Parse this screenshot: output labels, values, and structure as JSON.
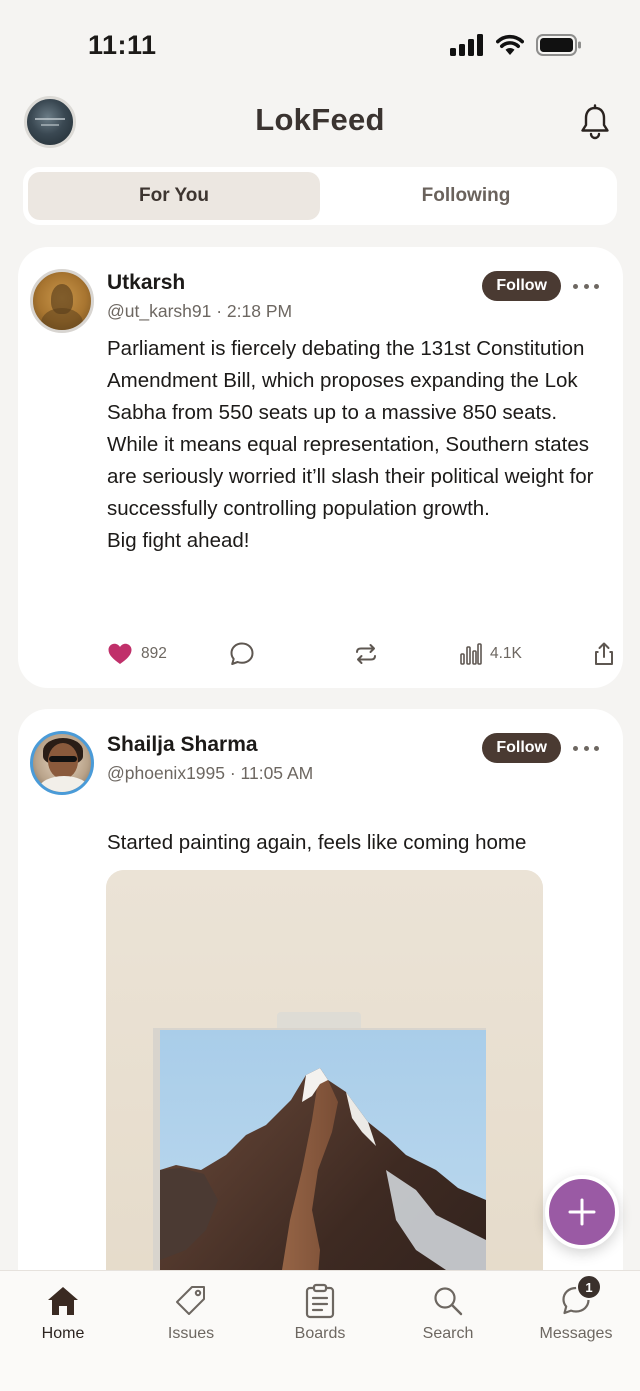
{
  "status_bar": {
    "time": "11:11"
  },
  "header": {
    "title": "LokFeed"
  },
  "tabs": [
    {
      "label": "For You",
      "active": true
    },
    {
      "label": "Following",
      "active": false
    }
  ],
  "posts": [
    {
      "name": "Utkarsh",
      "handle": "@ut_karsh91",
      "time": "2:18 PM",
      "meta": "@ut_karsh91 · 2:18 PM",
      "follow_label": "Follow",
      "text": "Parliament is fiercely debating the 131st Constitution Amendment Bill, which proposes expanding the Lok Sabha from 550 seats up to a massive 850 seats.\nWhile it means equal representation, Southern states are seriously worried it’ll slash their political weight for successfully controlling population growth.\n Big fight ahead!",
      "likes": "892",
      "views": "4.1K",
      "liked": true
    },
    {
      "name": "Shailja Sharma",
      "handle": "@phoenix1995",
      "time": "11:05 AM",
      "meta": "@phoenix1995 · 11:05 AM",
      "follow_label": "Follow",
      "text": "Started painting again, feels like coming home",
      "emoji": "😊"
    }
  ],
  "nav": [
    {
      "label": "Home",
      "icon": "home-icon",
      "active": true
    },
    {
      "label": "Issues",
      "icon": "tag-icon"
    },
    {
      "label": "Boards",
      "icon": "clipboard-icon"
    },
    {
      "label": "Search",
      "icon": "search-icon"
    },
    {
      "label": "Messages",
      "icon": "chat-bubble-icon",
      "badge": "1"
    }
  ],
  "colors": {
    "accent": "#9a5aa4",
    "follow": "#4a3a32",
    "like": "#c0306a",
    "background": "#f5f4f2"
  }
}
